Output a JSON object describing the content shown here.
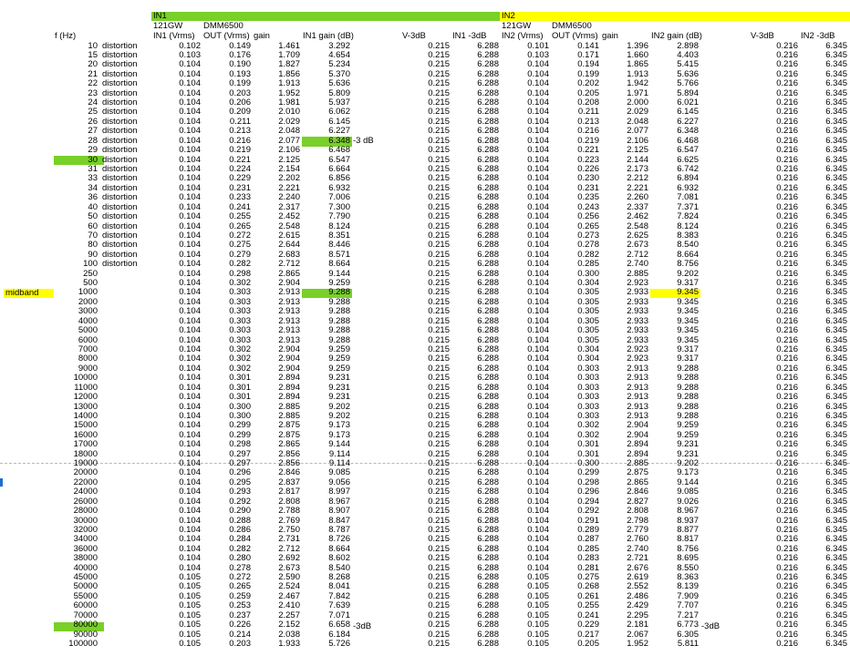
{
  "colors": {
    "in1": "#78d028",
    "in2": "#ffff00",
    "highlight_green": "#78d028",
    "highlight_yellow": "#ffff00"
  },
  "bands": {
    "in1": "IN1",
    "in2": "IN2"
  },
  "header_row2": {
    "in1_meter": "121GW",
    "in1_meter2": "DMM6500",
    "in2_meter": "121GW",
    "in2_meter2": "DMM6500"
  },
  "headers": {
    "f": "f (Hz)",
    "in1_vrms": "IN1 (Vrms)",
    "out_vrms": "OUT (Vrms)",
    "gain": "gain",
    "in1_gain_db": "IN1 gain (dB)",
    "v3db": "V-3dB",
    "in1_3db": "IN1 -3dB",
    "in2_vrms": "IN2 (Vrms)",
    "out2_vrms": "OUT (Vrms)",
    "gain2": "gain",
    "in2_gain_db": "IN2 gain (dB)",
    "v3db2": "V-3dB",
    "in2_3db": "IN2 -3dB"
  },
  "side_labels": {
    "midband": "midband",
    "minus3db": "-3 dB",
    "minus3db_b": "-3dB"
  },
  "rows": [
    [
      "10",
      "distortion",
      "0.102",
      "0.149",
      "1.461",
      "3.292",
      "0.215",
      "6.288",
      "0.101",
      "0.141",
      "1.396",
      "2.898",
      "0.216",
      "6.345"
    ],
    [
      "15",
      "distortion",
      "0.103",
      "0.176",
      "1.709",
      "4.654",
      "0.215",
      "6.288",
      "0.103",
      "0.171",
      "1.660",
      "4.403",
      "0.216",
      "6.345"
    ],
    [
      "20",
      "distortion",
      "0.104",
      "0.190",
      "1.827",
      "5.234",
      "0.215",
      "6.288",
      "0.104",
      "0.194",
      "1.865",
      "5.415",
      "0.216",
      "6.345"
    ],
    [
      "21",
      "distortion",
      "0.104",
      "0.193",
      "1.856",
      "5.370",
      "0.215",
      "6.288",
      "0.104",
      "0.199",
      "1.913",
      "5.636",
      "0.216",
      "6.345"
    ],
    [
      "22",
      "distortion",
      "0.104",
      "0.199",
      "1.913",
      "5.636",
      "0.215",
      "6.288",
      "0.104",
      "0.202",
      "1.942",
      "5.766",
      "0.216",
      "6.345"
    ],
    [
      "23",
      "distortion",
      "0.104",
      "0.203",
      "1.952",
      "5.809",
      "0.215",
      "6.288",
      "0.104",
      "0.205",
      "1.971",
      "5.894",
      "0.216",
      "6.345"
    ],
    [
      "24",
      "distortion",
      "0.104",
      "0.206",
      "1.981",
      "5.937",
      "0.215",
      "6.288",
      "0.104",
      "0.208",
      "2.000",
      "6.021",
      "0.216",
      "6.345"
    ],
    [
      "25",
      "distortion",
      "0.104",
      "0.209",
      "2.010",
      "6.062",
      "0.215",
      "6.288",
      "0.104",
      "0.211",
      "2.029",
      "6.145",
      "0.216",
      "6.345"
    ],
    [
      "26",
      "distortion",
      "0.104",
      "0.211",
      "2.029",
      "6.145",
      "0.215",
      "6.288",
      "0.104",
      "0.213",
      "2.048",
      "6.227",
      "0.216",
      "6.345"
    ],
    [
      "27",
      "distortion",
      "0.104",
      "0.213",
      "2.048",
      "6.227",
      "0.215",
      "6.288",
      "0.104",
      "0.216",
      "2.077",
      "6.348",
      "0.216",
      "6.345"
    ],
    [
      "28",
      "distortion",
      "0.104",
      "0.216",
      "2.077",
      "6.348",
      "0.215",
      "6.288",
      "0.104",
      "0.219",
      "2.106",
      "6.468",
      "0.216",
      "6.345"
    ],
    [
      "29",
      "distortion",
      "0.104",
      "0.219",
      "2.106",
      "6.468",
      "0.215",
      "6.288",
      "0.104",
      "0.221",
      "2.125",
      "6.547",
      "0.216",
      "6.345"
    ],
    [
      "30",
      "distortion",
      "0.104",
      "0.221",
      "2.125",
      "6.547",
      "0.215",
      "6.288",
      "0.104",
      "0.223",
      "2.144",
      "6.625",
      "0.216",
      "6.345"
    ],
    [
      "31",
      "distortion",
      "0.104",
      "0.224",
      "2.154",
      "6.664",
      "0.215",
      "6.288",
      "0.104",
      "0.226",
      "2.173",
      "6.742",
      "0.216",
      "6.345"
    ],
    [
      "33",
      "distortion",
      "0.104",
      "0.229",
      "2.202",
      "6.856",
      "0.215",
      "6.288",
      "0.104",
      "0.230",
      "2.212",
      "6.894",
      "0.216",
      "6.345"
    ],
    [
      "34",
      "distortion",
      "0.104",
      "0.231",
      "2.221",
      "6.932",
      "0.215",
      "6.288",
      "0.104",
      "0.231",
      "2.221",
      "6.932",
      "0.216",
      "6.345"
    ],
    [
      "36",
      "distortion",
      "0.104",
      "0.233",
      "2.240",
      "7.006",
      "0.215",
      "6.288",
      "0.104",
      "0.235",
      "2.260",
      "7.081",
      "0.216",
      "6.345"
    ],
    [
      "40",
      "distortion",
      "0.104",
      "0.241",
      "2.317",
      "7.300",
      "0.215",
      "6.288",
      "0.104",
      "0.243",
      "2.337",
      "7.371",
      "0.216",
      "6.345"
    ],
    [
      "50",
      "distortion",
      "0.104",
      "0.255",
      "2.452",
      "7.790",
      "0.215",
      "6.288",
      "0.104",
      "0.256",
      "2.462",
      "7.824",
      "0.216",
      "6.345"
    ],
    [
      "60",
      "distortion",
      "0.104",
      "0.265",
      "2.548",
      "8.124",
      "0.215",
      "6.288",
      "0.104",
      "0.265",
      "2.548",
      "8.124",
      "0.216",
      "6.345"
    ],
    [
      "70",
      "distortion",
      "0.104",
      "0.272",
      "2.615",
      "8.351",
      "0.215",
      "6.288",
      "0.104",
      "0.273",
      "2.625",
      "8.383",
      "0.216",
      "6.345"
    ],
    [
      "80",
      "distortion",
      "0.104",
      "0.275",
      "2.644",
      "8.446",
      "0.215",
      "6.288",
      "0.104",
      "0.278",
      "2.673",
      "8.540",
      "0.216",
      "6.345"
    ],
    [
      "90",
      "distortion",
      "0.104",
      "0.279",
      "2.683",
      "8.571",
      "0.215",
      "6.288",
      "0.104",
      "0.282",
      "2.712",
      "8.664",
      "0.216",
      "6.345"
    ],
    [
      "100",
      "distortion",
      "0.104",
      "0.282",
      "2.712",
      "8.664",
      "0.215",
      "6.288",
      "0.104",
      "0.285",
      "2.740",
      "8.756",
      "0.216",
      "6.345"
    ],
    [
      "250",
      "",
      "0.104",
      "0.298",
      "2.865",
      "9.144",
      "0.215",
      "6.288",
      "0.104",
      "0.300",
      "2.885",
      "9.202",
      "0.216",
      "6.345"
    ],
    [
      "500",
      "",
      "0.104",
      "0.302",
      "2.904",
      "9.259",
      "0.215",
      "6.288",
      "0.104",
      "0.304",
      "2.923",
      "9.317",
      "0.216",
      "6.345"
    ],
    [
      "1000",
      "",
      "0.104",
      "0.303",
      "2.913",
      "9.288",
      "0.215",
      "6.288",
      "0.104",
      "0.305",
      "2.933",
      "9.345",
      "0.216",
      "6.345"
    ],
    [
      "2000",
      "",
      "0.104",
      "0.303",
      "2.913",
      "9.288",
      "0.215",
      "6.288",
      "0.104",
      "0.305",
      "2.933",
      "9.345",
      "0.216",
      "6.345"
    ],
    [
      "3000",
      "",
      "0.104",
      "0.303",
      "2.913",
      "9.288",
      "0.215",
      "6.288",
      "0.104",
      "0.305",
      "2.933",
      "9.345",
      "0.216",
      "6.345"
    ],
    [
      "4000",
      "",
      "0.104",
      "0.303",
      "2.913",
      "9.288",
      "0.215",
      "6.288",
      "0.104",
      "0.305",
      "2.933",
      "9.345",
      "0.216",
      "6.345"
    ],
    [
      "5000",
      "",
      "0.104",
      "0.303",
      "2.913",
      "9.288",
      "0.215",
      "6.288",
      "0.104",
      "0.305",
      "2.933",
      "9.345",
      "0.216",
      "6.345"
    ],
    [
      "6000",
      "",
      "0.104",
      "0.303",
      "2.913",
      "9.288",
      "0.215",
      "6.288",
      "0.104",
      "0.305",
      "2.933",
      "9.345",
      "0.216",
      "6.345"
    ],
    [
      "7000",
      "",
      "0.104",
      "0.302",
      "2.904",
      "9.259",
      "0.215",
      "6.288",
      "0.104",
      "0.304",
      "2.923",
      "9.317",
      "0.216",
      "6.345"
    ],
    [
      "8000",
      "",
      "0.104",
      "0.302",
      "2.904",
      "9.259",
      "0.215",
      "6.288",
      "0.104",
      "0.304",
      "2.923",
      "9.317",
      "0.216",
      "6.345"
    ],
    [
      "9000",
      "",
      "0.104",
      "0.302",
      "2.904",
      "9.259",
      "0.215",
      "6.288",
      "0.104",
      "0.303",
      "2.913",
      "9.288",
      "0.216",
      "6.345"
    ],
    [
      "10000",
      "",
      "0.104",
      "0.301",
      "2.894",
      "9.231",
      "0.215",
      "6.288",
      "0.104",
      "0.303",
      "2.913",
      "9.288",
      "0.216",
      "6.345"
    ],
    [
      "11000",
      "",
      "0.104",
      "0.301",
      "2.894",
      "9.231",
      "0.215",
      "6.288",
      "0.104",
      "0.303",
      "2.913",
      "9.288",
      "0.216",
      "6.345"
    ],
    [
      "12000",
      "",
      "0.104",
      "0.301",
      "2.894",
      "9.231",
      "0.215",
      "6.288",
      "0.104",
      "0.303",
      "2.913",
      "9.288",
      "0.216",
      "6.345"
    ],
    [
      "13000",
      "",
      "0.104",
      "0.300",
      "2.885",
      "9.202",
      "0.215",
      "6.288",
      "0.104",
      "0.303",
      "2.913",
      "9.288",
      "0.216",
      "6.345"
    ],
    [
      "14000",
      "",
      "0.104",
      "0.300",
      "2.885",
      "9.202",
      "0.215",
      "6.288",
      "0.104",
      "0.303",
      "2.913",
      "9.288",
      "0.216",
      "6.345"
    ],
    [
      "15000",
      "",
      "0.104",
      "0.299",
      "2.875",
      "9.173",
      "0.215",
      "6.288",
      "0.104",
      "0.302",
      "2.904",
      "9.259",
      "0.216",
      "6.345"
    ],
    [
      "16000",
      "",
      "0.104",
      "0.299",
      "2.875",
      "9.173",
      "0.215",
      "6.288",
      "0.104",
      "0.302",
      "2.904",
      "9.259",
      "0.216",
      "6.345"
    ],
    [
      "17000",
      "",
      "0.104",
      "0.298",
      "2.865",
      "9.144",
      "0.215",
      "6.288",
      "0.104",
      "0.301",
      "2.894",
      "9.231",
      "0.216",
      "6.345"
    ],
    [
      "18000",
      "",
      "0.104",
      "0.297",
      "2.856",
      "9.114",
      "0.215",
      "6.288",
      "0.104",
      "0.301",
      "2.894",
      "9.231",
      "0.216",
      "6.345"
    ],
    [
      "19000",
      "",
      "0.104",
      "0.297",
      "2.856",
      "9.114",
      "0.215",
      "6.288",
      "0.104",
      "0.300",
      "2.885",
      "9.202",
      "0.216",
      "6.345"
    ],
    [
      "20000",
      "",
      "0.104",
      "0.296",
      "2.846",
      "9.085",
      "0.215",
      "6.288",
      "0.104",
      "0.299",
      "2.875",
      "9.173",
      "0.216",
      "6.345"
    ],
    [
      "22000",
      "",
      "0.104",
      "0.295",
      "2.837",
      "9.056",
      "0.215",
      "6.288",
      "0.104",
      "0.298",
      "2.865",
      "9.144",
      "0.216",
      "6.345"
    ],
    [
      "24000",
      "",
      "0.104",
      "0.293",
      "2.817",
      "8.997",
      "0.215",
      "6.288",
      "0.104",
      "0.296",
      "2.846",
      "9.085",
      "0.216",
      "6.345"
    ],
    [
      "26000",
      "",
      "0.104",
      "0.292",
      "2.808",
      "8.967",
      "0.215",
      "6.288",
      "0.104",
      "0.294",
      "2.827",
      "9.026",
      "0.216",
      "6.345"
    ],
    [
      "28000",
      "",
      "0.104",
      "0.290",
      "2.788",
      "8.907",
      "0.215",
      "6.288",
      "0.104",
      "0.292",
      "2.808",
      "8.967",
      "0.216",
      "6.345"
    ],
    [
      "30000",
      "",
      "0.104",
      "0.288",
      "2.769",
      "8.847",
      "0.215",
      "6.288",
      "0.104",
      "0.291",
      "2.798",
      "8.937",
      "0.216",
      "6.345"
    ],
    [
      "32000",
      "",
      "0.104",
      "0.286",
      "2.750",
      "8.787",
      "0.215",
      "6.288",
      "0.104",
      "0.289",
      "2.779",
      "8.877",
      "0.216",
      "6.345"
    ],
    [
      "34000",
      "",
      "0.104",
      "0.284",
      "2.731",
      "8.726",
      "0.215",
      "6.288",
      "0.104",
      "0.287",
      "2.760",
      "8.817",
      "0.216",
      "6.345"
    ],
    [
      "36000",
      "",
      "0.104",
      "0.282",
      "2.712",
      "8.664",
      "0.215",
      "6.288",
      "0.104",
      "0.285",
      "2.740",
      "8.756",
      "0.216",
      "6.345"
    ],
    [
      "38000",
      "",
      "0.104",
      "0.280",
      "2.692",
      "8.602",
      "0.215",
      "6.288",
      "0.104",
      "0.283",
      "2.721",
      "8.695",
      "0.216",
      "6.345"
    ],
    [
      "40000",
      "",
      "0.104",
      "0.278",
      "2.673",
      "8.540",
      "0.215",
      "6.288",
      "0.104",
      "0.281",
      "2.676",
      "8.550",
      "0.216",
      "6.345"
    ],
    [
      "45000",
      "",
      "0.105",
      "0.272",
      "2.590",
      "8.268",
      "0.215",
      "6.288",
      "0.105",
      "0.275",
      "2.619",
      "8.363",
      "0.216",
      "6.345"
    ],
    [
      "50000",
      "",
      "0.105",
      "0.265",
      "2.524",
      "8.041",
      "0.215",
      "6.288",
      "0.105",
      "0.268",
      "2.552",
      "8.139",
      "0.216",
      "6.345"
    ],
    [
      "55000",
      "",
      "0.105",
      "0.259",
      "2.467",
      "7.842",
      "0.215",
      "6.288",
      "0.105",
      "0.261",
      "2.486",
      "7.909",
      "0.216",
      "6.345"
    ],
    [
      "60000",
      "",
      "0.105",
      "0.253",
      "2.410",
      "7.639",
      "0.215",
      "6.288",
      "0.105",
      "0.255",
      "2.429",
      "7.707",
      "0.216",
      "6.345"
    ],
    [
      "70000",
      "",
      "0.105",
      "0.237",
      "2.257",
      "7.071",
      "0.215",
      "6.288",
      "0.105",
      "0.241",
      "2.295",
      "7.217",
      "0.216",
      "6.345"
    ],
    [
      "80000",
      "",
      "0.105",
      "0.226",
      "2.152",
      "6.658",
      "0.215",
      "6.288",
      "0.105",
      "0.229",
      "2.181",
      "6.773",
      "0.216",
      "6.345"
    ],
    [
      "90000",
      "",
      "0.105",
      "0.214",
      "2.038",
      "6.184",
      "0.215",
      "6.288",
      "0.105",
      "0.217",
      "2.067",
      "6.305",
      "0.216",
      "6.345"
    ],
    [
      "100000",
      "",
      "0.105",
      "0.203",
      "1.933",
      "5.726",
      "0.215",
      "6.288",
      "0.105",
      "0.205",
      "1.952",
      "5.811",
      "0.216",
      "6.345"
    ]
  ]
}
